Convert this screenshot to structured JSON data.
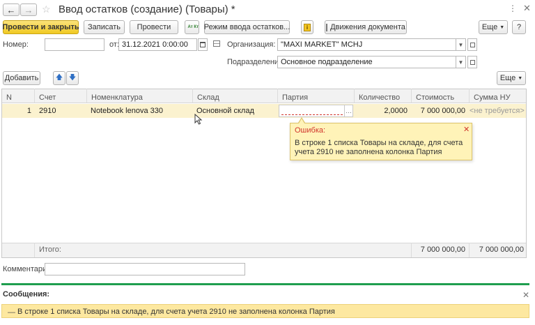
{
  "window": {
    "title": "Ввод остатков (создание) (Товары) *"
  },
  "toolbar": {
    "post_close_label": "Провести и закрыть",
    "save_label": "Записать",
    "post_label": "Провести",
    "dtkt_label": "Ат Кт",
    "mode_label": "Режим ввода остатков...",
    "movements_label": "Движения документа",
    "more_label": "Еще",
    "help_label": "?"
  },
  "form": {
    "number_label": "Номер:",
    "number_value": "",
    "date_label": "от:",
    "date_value": "31.12.2021  0:00:00",
    "org_label": "Организация:",
    "org_value": "\"MAXI MARKET\" MCHJ",
    "dept_label": "Подразделение:",
    "dept_value": "Основное подразделение"
  },
  "table_toolbar": {
    "add_label": "Добавить",
    "more_label": "Еще"
  },
  "table": {
    "columns": [
      "N",
      "Счет",
      "Номенклатура",
      "Склад",
      "Партия",
      "Количество",
      "Стоимость",
      "Сумма НУ"
    ],
    "rows": [
      {
        "n": "1",
        "account": "2910",
        "item": "Notebook lenova 330",
        "warehouse": "Основной склад",
        "batch": "",
        "quantity": "2,0000",
        "cost": "7 000 000,00",
        "sum_nu": "<не требуется>"
      }
    ],
    "footer": {
      "label": "Итого:",
      "cost_total": "7 000 000,00",
      "sum_nu_total": "7 000 000,00"
    }
  },
  "tooltip": {
    "title": "Ошибка:",
    "message": "В строке 1 списка Товары на складе, для счета учета 2910 не заполнена колонка Партия"
  },
  "comment": {
    "label": "Комментарий:",
    "value": ""
  },
  "messages": {
    "title": "Сообщения:",
    "items": [
      "В строке 1 списка Товары на складе, для счета учета 2910 не заполнена колонка Партия"
    ]
  },
  "colors": {
    "accent_yellow": "#f5d542",
    "row_highlight": "#fbf2cf",
    "tooltip_bg": "#fff3b8",
    "error_red": "#d0342c",
    "messages_green": "#1f9e4f",
    "message_bg": "#fde8a0"
  }
}
